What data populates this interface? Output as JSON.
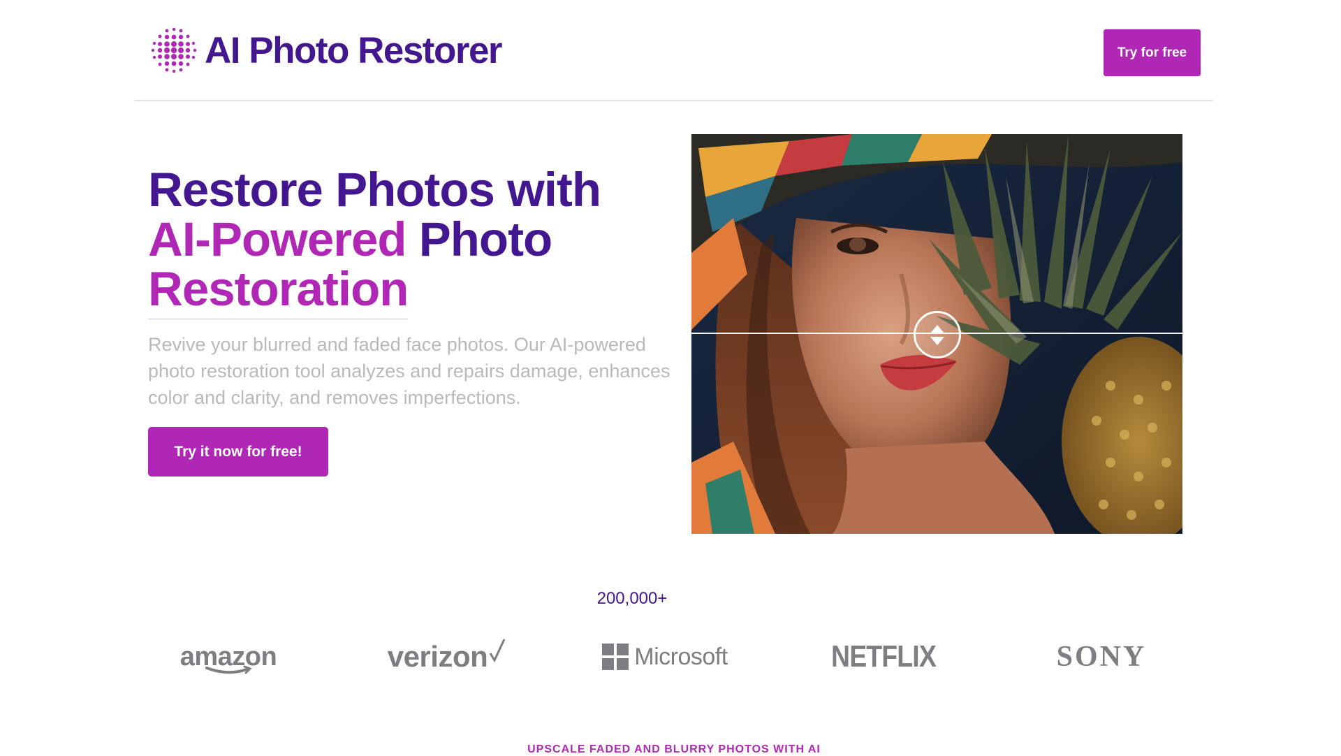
{
  "header": {
    "brand": "AI Photo Restorer",
    "cta_label": "Try for free"
  },
  "hero": {
    "title_line1": "Restore Photos with",
    "title_accent": "AI-Powered",
    "title_line2_rest": " Photo",
    "title_line3": "Restoration",
    "description": "Revive your blurred and faded face photos. Our AI-powered photo restoration tool analyzes and repairs damage, enhances color and clarity, and removes imperfections.",
    "cta_label": "Try it now for free!"
  },
  "comparison": {
    "handle_icon": "vertical-arrows-icon"
  },
  "social_proof": {
    "users_count": "200,000+",
    "brands": [
      "amazon",
      "verizon",
      "Microsoft",
      "NETFLIX",
      "SONY"
    ]
  },
  "next_section": {
    "kicker": "UPSCALE FADED AND BLURRY PHOTOS WITH AI"
  },
  "colors": {
    "primary_dark": "#43178f",
    "accent": "#b026b5",
    "muted_text": "#b9b9bd",
    "brand_gray": "#7d7d82"
  }
}
